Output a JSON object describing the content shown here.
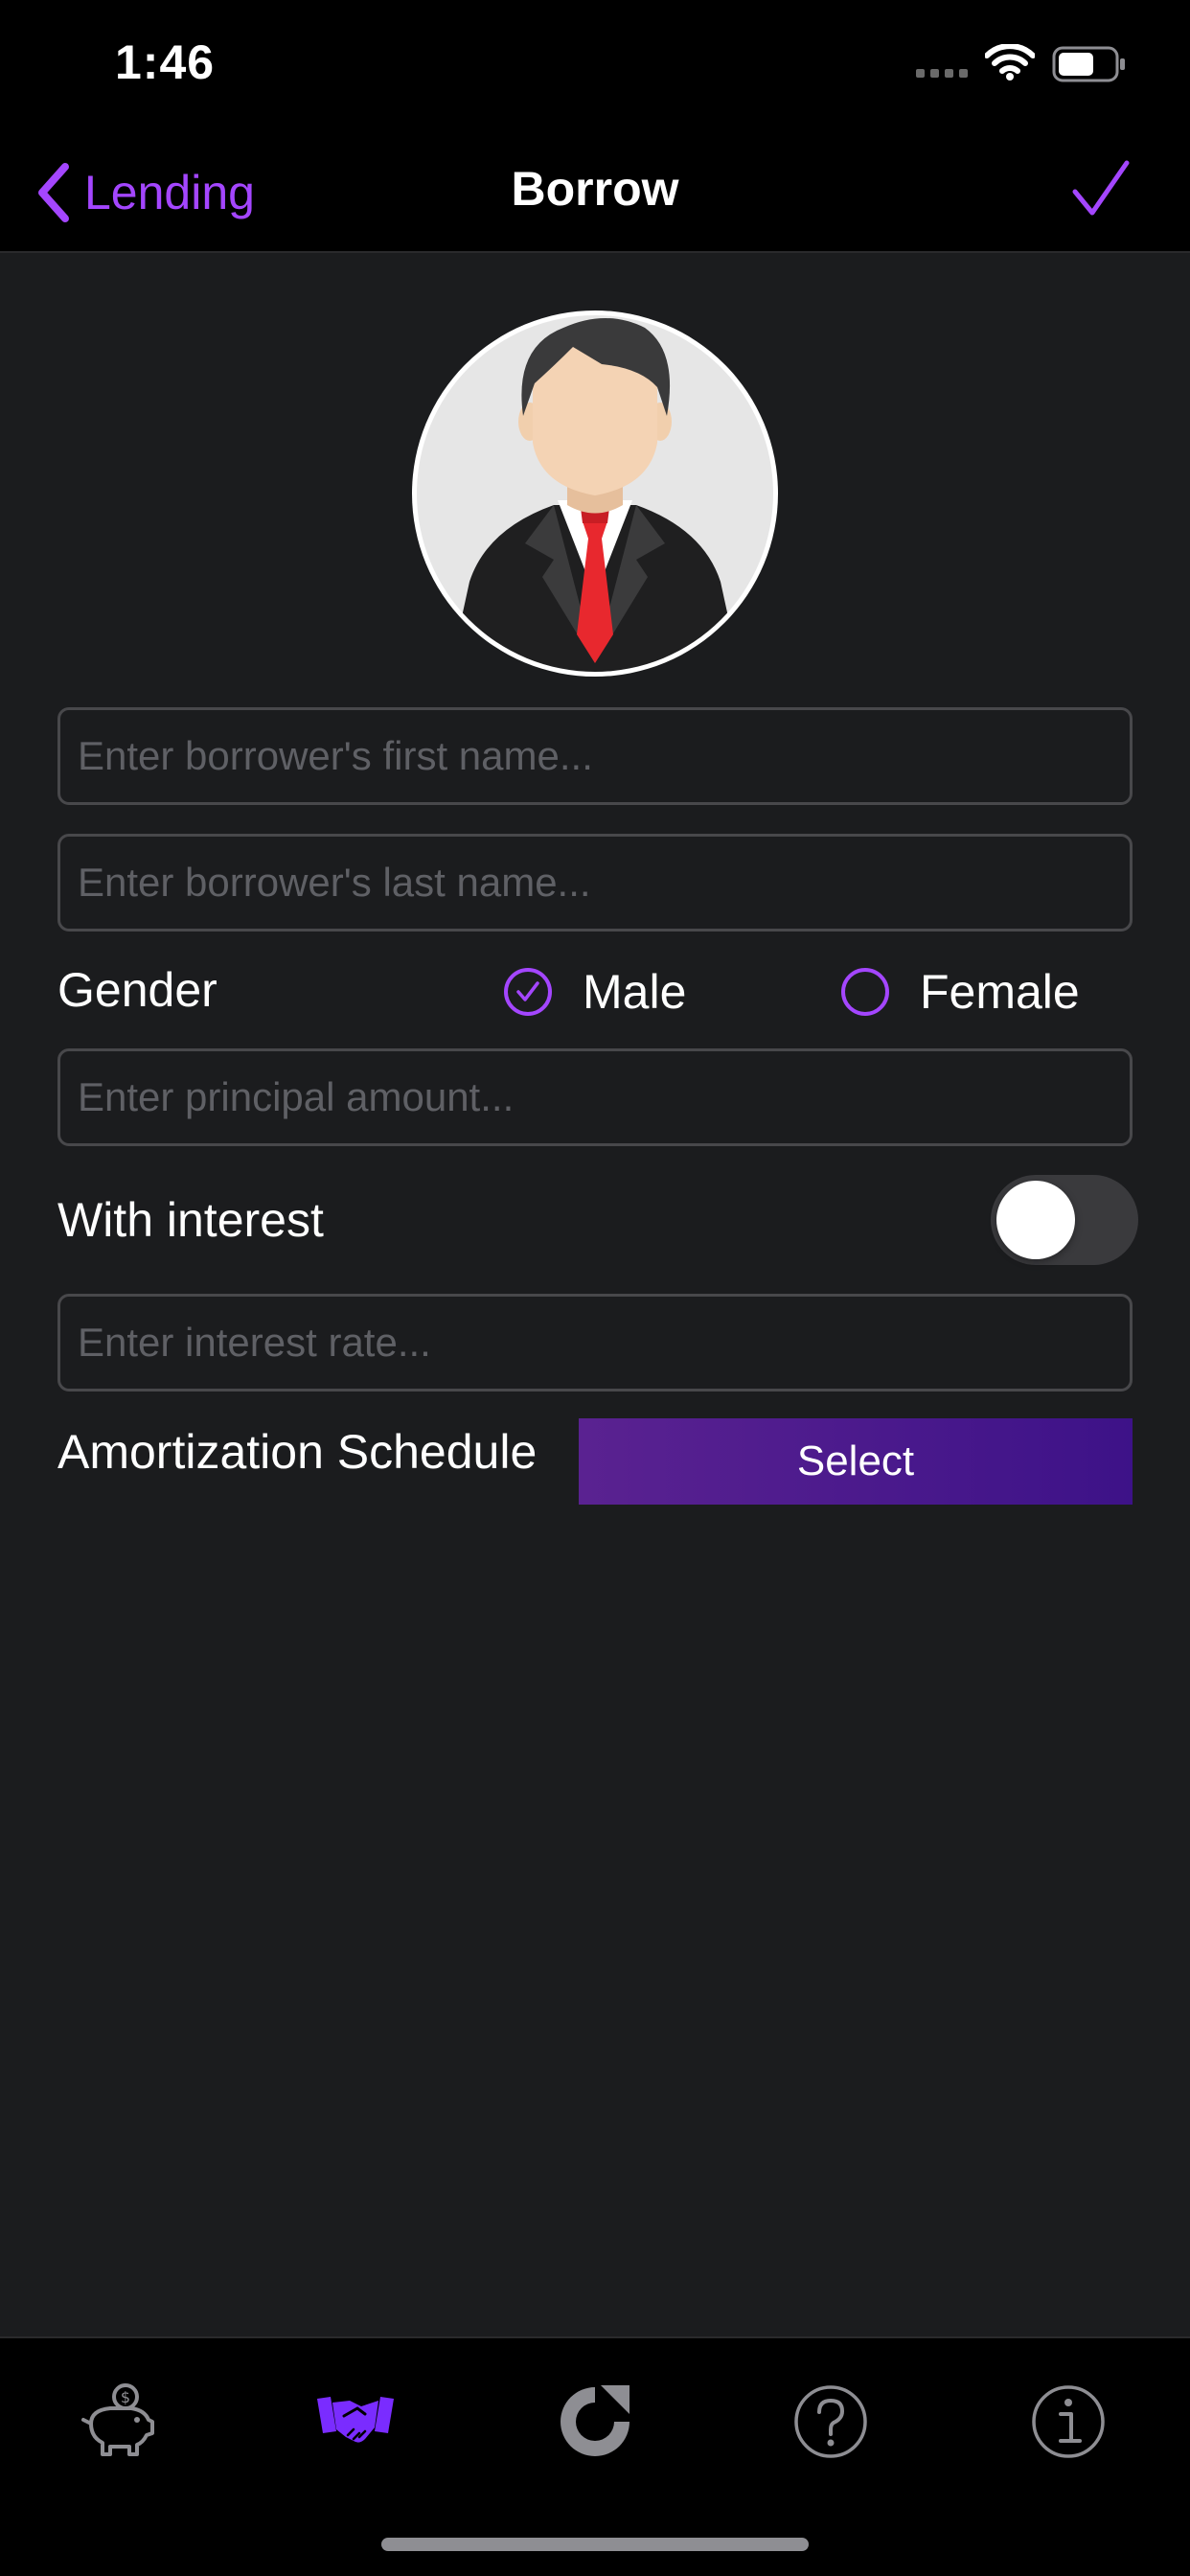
{
  "status_bar": {
    "time": "1:46"
  },
  "nav": {
    "back_label": "Lending",
    "title": "Borrow"
  },
  "form": {
    "first_name": {
      "placeholder": "Enter borrower's first name...",
      "value": ""
    },
    "last_name": {
      "placeholder": "Enter borrower's last name...",
      "value": ""
    },
    "gender": {
      "label": "Gender",
      "options": [
        "Male",
        "Female"
      ],
      "selected": "Male"
    },
    "principal": {
      "placeholder": "Enter principal amount...",
      "value": ""
    },
    "with_interest": {
      "label": "With interest",
      "enabled": false
    },
    "interest_rate": {
      "placeholder": "Enter interest rate...",
      "value": ""
    },
    "amortization": {
      "label": "Amortization Schedule",
      "button_label": "Select"
    }
  },
  "tab_bar": {
    "tabs": [
      {
        "icon": "piggy-bank-icon",
        "selected": false
      },
      {
        "icon": "handshake-icon",
        "selected": true
      },
      {
        "icon": "refresh-icon",
        "selected": false
      },
      {
        "icon": "help-icon",
        "selected": false
      },
      {
        "icon": "info-icon",
        "selected": false
      }
    ]
  },
  "colors": {
    "accent": "#a446ff",
    "background": "#1b1c1e",
    "bar_background": "#000000",
    "input_border": "#48484b",
    "placeholder": "#5f6065",
    "tab_inactive": "#8e8e93",
    "select_button_start": "#5a2291",
    "select_button_end": "#3d1288"
  }
}
